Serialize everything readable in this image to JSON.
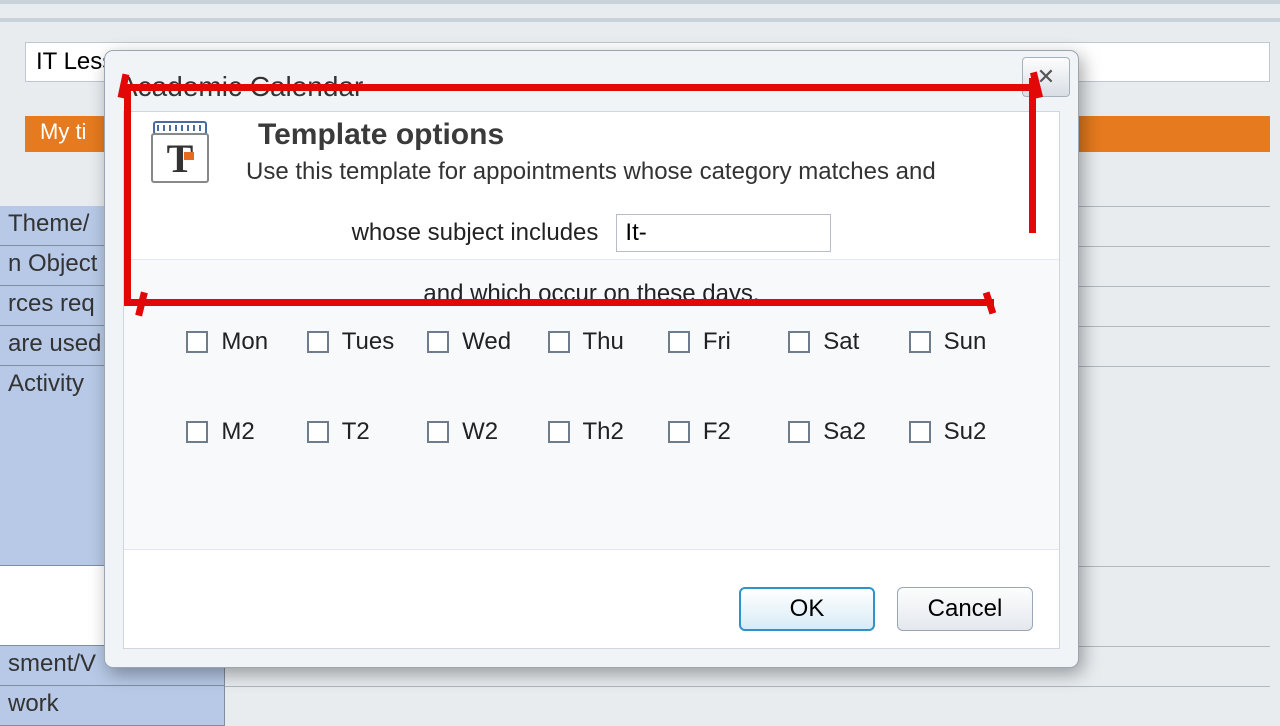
{
  "bg": {
    "search_value": "IT Less",
    "orange_tab": "My ti",
    "side_items": [
      "Theme/",
      "n Object",
      "rces req",
      "are used",
      "Activity",
      "sment/V",
      "work"
    ]
  },
  "dialog": {
    "title": "Academic Calendar",
    "close_glyph": "✕",
    "heading": "Template options",
    "subtext": "Use this template for appointments whose category matches and",
    "subject_label": "whose subject includes",
    "subject_value": "It-",
    "days_caption": "and which occur on these days.",
    "days_row1": [
      "Mon",
      "Tues",
      "Wed",
      "Thu",
      "Fri",
      "Sat",
      "Sun"
    ],
    "days_row2": [
      "M2",
      "T2",
      "W2",
      "Th2",
      "F2",
      "Sa2",
      "Su2"
    ],
    "ok_label": "OK",
    "cancel_label": "Cancel"
  }
}
